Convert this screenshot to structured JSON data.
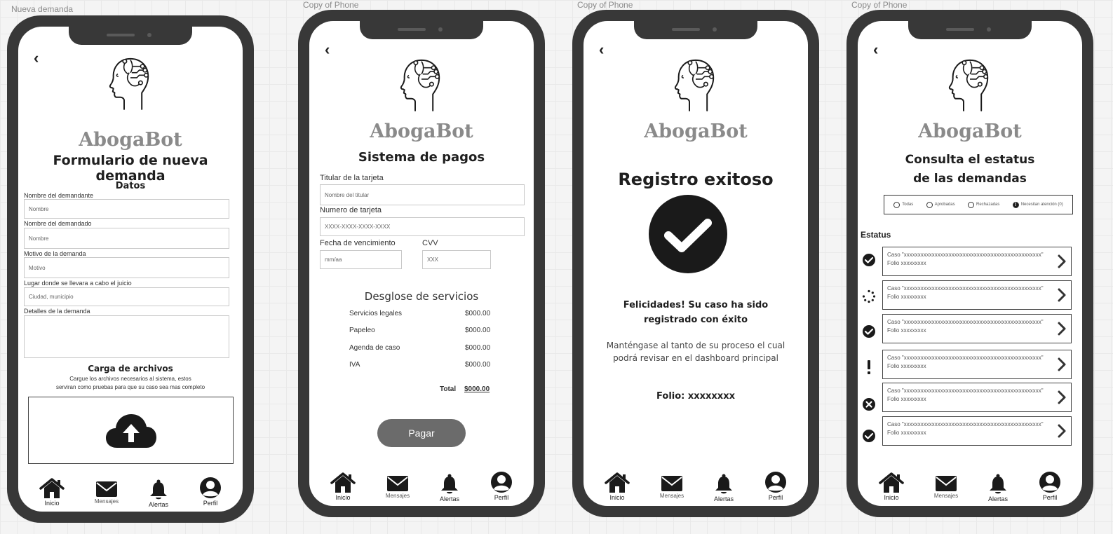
{
  "frames": [
    {
      "label": "Nueva demanda"
    },
    {
      "label": "Copy of Phone"
    },
    {
      "label": "Copy of Phone"
    },
    {
      "label": "Copy of Phone"
    }
  ],
  "brand": "AbogaBot",
  "nav": {
    "inicio": "Inicio",
    "mensajes": "Mensajes",
    "alertas": "Alertas",
    "perfil": "Perfil"
  },
  "form": {
    "title": "Formulario de nueva demanda",
    "section": "Datos",
    "fields": [
      {
        "label": "Nombre del demandante",
        "placeholder": "Nombre"
      },
      {
        "label": "Nombre del demandado",
        "placeholder": "Nombre"
      },
      {
        "label": "Motivo de la demanda",
        "placeholder": "Motivo"
      },
      {
        "label": "Lugar donde se llevara a cabo el juicio",
        "placeholder": "Ciudad, municipio"
      },
      {
        "label": "Detalles de la demanda",
        "placeholder": ""
      }
    ],
    "upload_title": "Carga de archivos",
    "upload_desc_1": "Cargue los archivos necesarios al sistema, estos",
    "upload_desc_2": "serviran como pruebas para que su caso sea mas completo"
  },
  "payment": {
    "title": "Sistema de pagos",
    "holder_label": "Titular de la tarjeta",
    "holder_placeholder": "Nombre del titular",
    "number_label": "Numero de tarjeta",
    "number_placeholder": "XXXX-XXXX-XXXX-XXXX",
    "expiry_label": "Fecha de vencimiento",
    "expiry_placeholder": "mm/aa",
    "cvv_label": "CVV",
    "cvv_placeholder": "XXX",
    "breakdown_title": "Desglose de servicios",
    "services": [
      {
        "name": "Servicios legales",
        "price": "$000.00"
      },
      {
        "name": "Papeleo",
        "price": "$000.00"
      },
      {
        "name": "Agenda de caso",
        "price": "$000.00"
      },
      {
        "name": "IVA",
        "price": "$000.00"
      }
    ],
    "total_label": "Total",
    "total_value": "$000.00",
    "pay_button": "Pagar"
  },
  "success": {
    "title": "Registro exitoso",
    "message_1": "Felicidades! Su caso ha sido",
    "message_2": "registrado con éxito",
    "info_1": "Manténgase al tanto de su proceso el cual",
    "info_2": "podrá revisar en el dashboard principal",
    "folio": "Folio: xxxxxxxx"
  },
  "status": {
    "title_1": "Consulta el estatus",
    "title_2": "de las demandas",
    "filters": [
      "Todas",
      "Aprobadas",
      "Rechazadas",
      "Necesitan atención (0)"
    ],
    "section": "Estatus",
    "cases": [
      {
        "icon": "check-circle-icon",
        "title": "Caso \"xxxxxxxxxxxxxxxxxxxxxxxxxxxxxxxxxxxxxxxxxxxxxxxxx\"",
        "folio": "Folio xxxxxxxxx"
      },
      {
        "icon": "loading-icon",
        "title": "Caso \"xxxxxxxxxxxxxxxxxxxxxxxxxxxxxxxxxxxxxxxxxxxxxxxxx\"",
        "folio": "Folio xxxxxxxxx"
      },
      {
        "icon": "check-circle-icon",
        "title": "Caso \"xxxxxxxxxxxxxxxxxxxxxxxxxxxxxxxxxxxxxxxxxxxxxxxxx\"",
        "folio": "Folio xxxxxxxxx"
      },
      {
        "icon": "exclamation-icon",
        "title": "Caso \"xxxxxxxxxxxxxxxxxxxxxxxxxxxxxxxxxxxxxxxxxxxxxxxxx\"",
        "folio": "Folio xxxxxxxxx"
      },
      {
        "icon": "x-circle-icon",
        "title": "Caso \"xxxxxxxxxxxxxxxxxxxxxxxxxxxxxxxxxxxxxxxxxxxxxxxxx\"",
        "folio": "Folio xxxxxxxxx"
      },
      {
        "icon": "check-circle-icon",
        "title": "Caso \"xxxxxxxxxxxxxxxxxxxxxxxxxxxxxxxxxxxxxxxxxxxxxxxxx\"",
        "folio": "Folio xxxxxxxxx"
      }
    ]
  },
  "colors": {
    "phone": "#383838",
    "button": "#6b6b6b",
    "brand": "#8a8a8a"
  }
}
